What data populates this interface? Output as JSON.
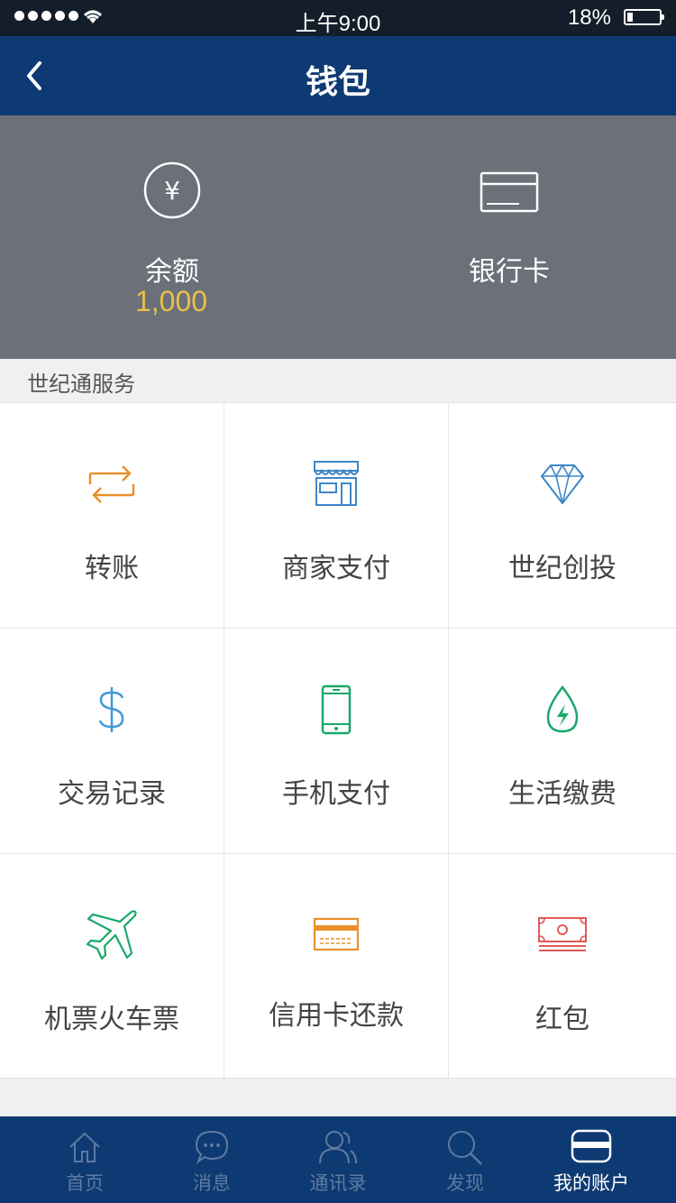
{
  "status_bar": {
    "time": "上午9:00",
    "battery": "18%"
  },
  "nav": {
    "title": "钱包"
  },
  "hero": {
    "balance_label": "余额",
    "balance_amount": "1,000",
    "bank_card_label": "银行卡",
    "yuan_symbol": "¥"
  },
  "section": {
    "title": "世纪通服务"
  },
  "services": [
    {
      "label": "转账",
      "icon": "transfer-icon",
      "color": "#e8912b"
    },
    {
      "label": "商家支付",
      "icon": "store-icon",
      "color": "#3f86c6"
    },
    {
      "label": "世纪创投",
      "icon": "diamond-icon",
      "color": "#3f86c6"
    },
    {
      "label": "交易记录",
      "icon": "dollar-icon",
      "color": "#3f9ad6"
    },
    {
      "label": "手机支付",
      "icon": "phone-icon",
      "color": "#1aa86b"
    },
    {
      "label": "生活缴费",
      "icon": "energy-drop-icon",
      "color": "#1aa86b"
    },
    {
      "label": "机票火车票",
      "icon": "airplane-icon",
      "color": "#1aa86b"
    },
    {
      "label": "信用卡还款",
      "icon": "credit-card-icon",
      "color": "#e8912b"
    },
    {
      "label": "红包",
      "icon": "money-bill-icon",
      "color": "#e05a5a"
    }
  ],
  "tabs": [
    {
      "label": "首页",
      "icon": "home-icon"
    },
    {
      "label": "消息",
      "icon": "chat-icon"
    },
    {
      "label": "通讯录",
      "icon": "contacts-icon"
    },
    {
      "label": "发现",
      "icon": "search-icon"
    },
    {
      "label": "我的账户",
      "icon": "card-icon",
      "active": true
    }
  ],
  "colors": {
    "navbar": "#0d3a72",
    "hero": "#6b7079",
    "balance": "#e8c048"
  }
}
